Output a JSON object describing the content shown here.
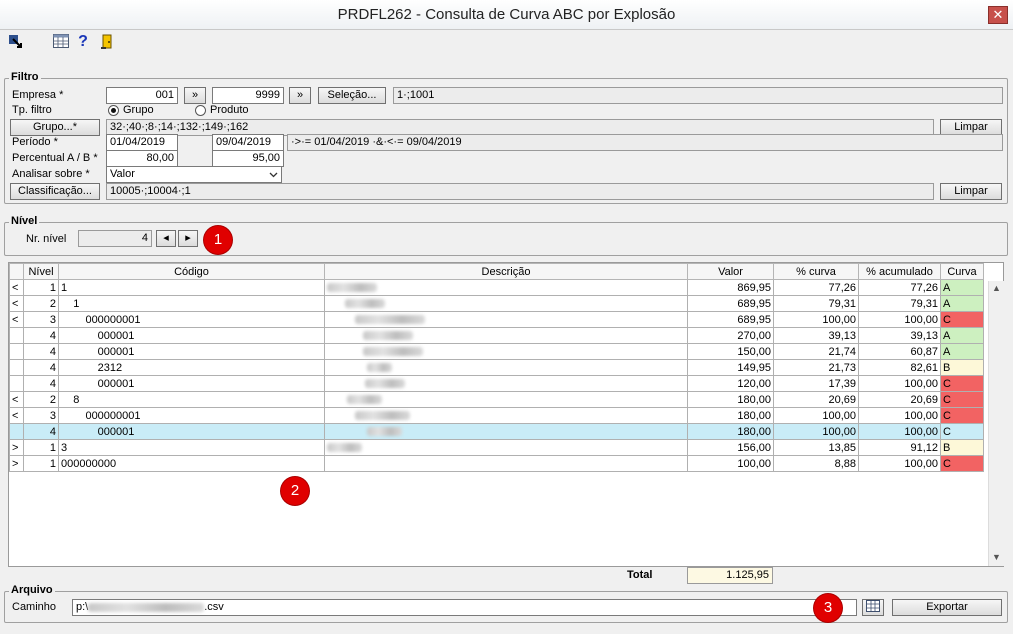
{
  "window": {
    "title": "PRDFL262 - Consulta de Curva ABC por Explosão",
    "close": "✕"
  },
  "toolbar": {
    "icons": [
      "export-icon",
      "grid-icon",
      "help-icon",
      "exit-icon"
    ]
  },
  "filtro": {
    "title": "Filtro",
    "empresa_label": "Empresa *",
    "empresa_from": "001",
    "empresa_to": "9999",
    "nav_btn": "»",
    "selecao_btn": "Seleção...",
    "selecao_value": "1·;1001",
    "tp_filtro_label": "Tp. filtro",
    "radio_grupo": "Grupo",
    "radio_produto": "Produto",
    "grupo_btn": "Grupo...*",
    "grupo_value": "32·;40·;8·;14·;132·;149·;162",
    "limpar": "Limpar",
    "periodo_label": "Período *",
    "periodo_from": "01/04/2019",
    "periodo_to": "09/04/2019",
    "periodo_desc": "·>·= 01/04/2019 ·&·<·= 09/04/2019",
    "percentual_label": "Percentual A / B *",
    "percentual_a": "80,00",
    "percentual_b": "95,00",
    "analisar_label": "Analisar sobre *",
    "analisar_value": "Valor",
    "classificacao_btn": "Classificação...",
    "classificacao_value": "10005·;10004·;1"
  },
  "nivel": {
    "title": "Nível",
    "nr_label": "Nr. nível",
    "nr_value": "4",
    "prev": "◂",
    "next": "▸"
  },
  "grid": {
    "headers": [
      "",
      "Nível",
      "Código",
      "Descrição",
      "Valor",
      "% curva",
      "% acumulado",
      "Curva"
    ],
    "rows": [
      {
        "exp": "<",
        "nivel": "1",
        "codigo": "1",
        "desc_w": 50,
        "desc_i": 0,
        "valor": "869,95",
        "curva": "77,26",
        "acum": "77,26",
        "abc": "A"
      },
      {
        "exp": "<",
        "nivel": "2",
        "codigo": "    1",
        "desc_w": 40,
        "desc_i": 18,
        "valor": "689,95",
        "curva": "79,31",
        "acum": "79,31",
        "abc": "A"
      },
      {
        "exp": "<",
        "nivel": "3",
        "codigo": "        000000001",
        "desc_w": 70,
        "desc_i": 28,
        "valor": "689,95",
        "curva": "100,00",
        "acum": "100,00",
        "abc": "C"
      },
      {
        "exp": "",
        "nivel": "4",
        "codigo": "            000001",
        "desc_w": 50,
        "desc_i": 36,
        "valor": "270,00",
        "curva": "39,13",
        "acum": "39,13",
        "abc": "A"
      },
      {
        "exp": "",
        "nivel": "4",
        "codigo": "            000001",
        "desc_w": 60,
        "desc_i": 36,
        "valor": "150,00",
        "curva": "21,74",
        "acum": "60,87",
        "abc": "A"
      },
      {
        "exp": "",
        "nivel": "4",
        "codigo": "            2312",
        "desc_w": 25,
        "desc_i": 40,
        "valor": "149,95",
        "curva": "21,73",
        "acum": "82,61",
        "abc": "B"
      },
      {
        "exp": "",
        "nivel": "4",
        "codigo": "            000001",
        "desc_w": 40,
        "desc_i": 38,
        "valor": "120,00",
        "curva": "17,39",
        "acum": "100,00",
        "abc": "C"
      },
      {
        "exp": "<",
        "nivel": "2",
        "codigo": "    8",
        "desc_w": 35,
        "desc_i": 20,
        "valor": "180,00",
        "curva": "20,69",
        "acum": "20,69",
        "abc": "C"
      },
      {
        "exp": "<",
        "nivel": "3",
        "codigo": "        000000001",
        "desc_w": 55,
        "desc_i": 28,
        "valor": "180,00",
        "curva": "100,00",
        "acum": "100,00",
        "abc": "C"
      },
      {
        "exp": "",
        "nivel": "4",
        "codigo": "            000001",
        "desc_w": 35,
        "desc_i": 40,
        "valor": "180,00",
        "curva": "100,00",
        "acum": "100,00",
        "abc": "C",
        "sel": true
      },
      {
        "exp": ">",
        "nivel": "1",
        "codigo": "3",
        "desc_w": 35,
        "desc_i": 0,
        "valor": "156,00",
        "curva": "13,85",
        "acum": "91,12",
        "abc": "B"
      },
      {
        "exp": ">",
        "nivel": "1",
        "codigo": "000000000",
        "desc_w": 0,
        "desc_i": 0,
        "valor": "100,00",
        "curva": "8,88",
        "acum": "100,00",
        "abc": "C"
      }
    ],
    "total_label": "Total",
    "total_value": "1.125,95"
  },
  "arquivo": {
    "title": "Arquivo",
    "caminho_label": "Caminho",
    "caminho_prefix": "p:\\",
    "caminho_suffix": ".csv",
    "exportar": "Exportar"
  },
  "badges": [
    "1",
    "2",
    "3"
  ],
  "colors": {
    "curva_A": "#cdf0c0",
    "curva_B": "#fdf8d8",
    "curva_C": "#f26363",
    "selected_row": "#c9ecf7",
    "badge": "#e00000"
  }
}
